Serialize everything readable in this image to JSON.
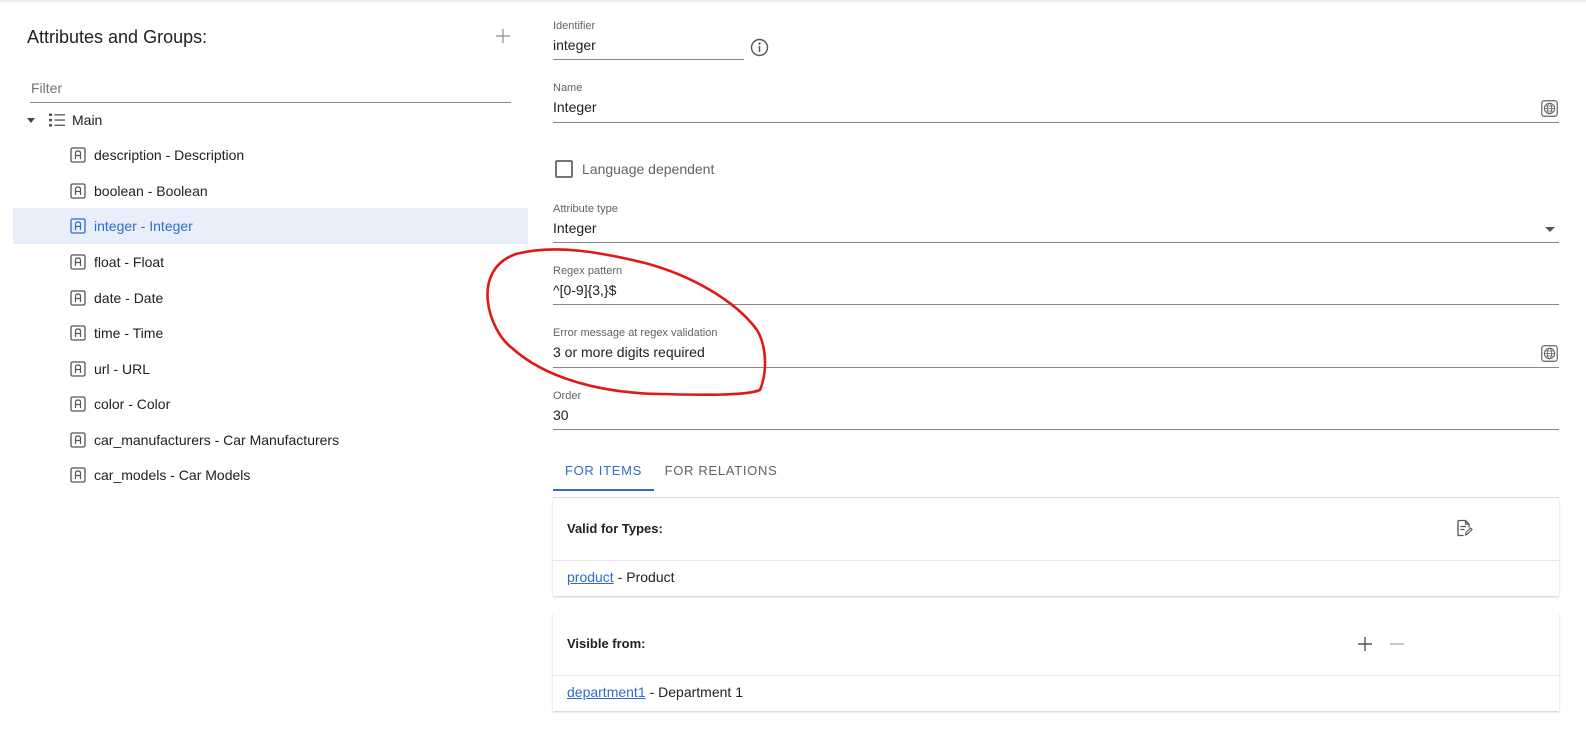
{
  "left_panel": {
    "title": "Attributes and Groups:",
    "filter_placeholder": "Filter",
    "root": {
      "label": "Main"
    },
    "items": [
      {
        "label": "description - Description"
      },
      {
        "label": "boolean - Boolean"
      },
      {
        "label": "integer - Integer",
        "selected": true
      },
      {
        "label": "float - Float"
      },
      {
        "label": "date - Date"
      },
      {
        "label": "time - Time"
      },
      {
        "label": "url - URL"
      },
      {
        "label": "color - Color"
      },
      {
        "label": "car_manufacturers - Car Manufacturers"
      },
      {
        "label": "car_models - Car Models"
      }
    ]
  },
  "form": {
    "identifier": {
      "label": "Identifier",
      "value": "integer"
    },
    "name": {
      "label": "Name",
      "value": "Integer"
    },
    "language_dependent": {
      "label": "Language dependent",
      "checked": false
    },
    "attribute_type": {
      "label": "Attribute type",
      "value": "Integer"
    },
    "regex_pattern": {
      "label": "Regex pattern",
      "value": "^[0-9]{3,}$"
    },
    "error_message": {
      "label": "Error message at regex validation",
      "value": "3 or more digits required"
    },
    "order": {
      "label": "Order",
      "value": "30"
    }
  },
  "tabs": [
    {
      "label": "FOR ITEMS",
      "active": true
    },
    {
      "label": "FOR RELATIONS",
      "active": false
    }
  ],
  "valid_for_types": {
    "title": "Valid for Types:",
    "rows": [
      {
        "link": "product",
        "desc": "- Product"
      }
    ]
  },
  "visible_from": {
    "title": "Visible from:",
    "rows": [
      {
        "link": "department1",
        "desc": "- Department 1"
      }
    ]
  },
  "colors": {
    "accent": "#2f6ad0",
    "selected_row_bg": "#e8effa",
    "annotation": "#e01818"
  },
  "icons": {
    "add": "plus-icon",
    "tree_toggle": "caret-down-icon",
    "group": "list-icon",
    "attribute": "attribute-icon",
    "info": "info-icon",
    "translate": "globe-icon",
    "edit": "edit-list-icon",
    "remove": "minus-icon"
  }
}
